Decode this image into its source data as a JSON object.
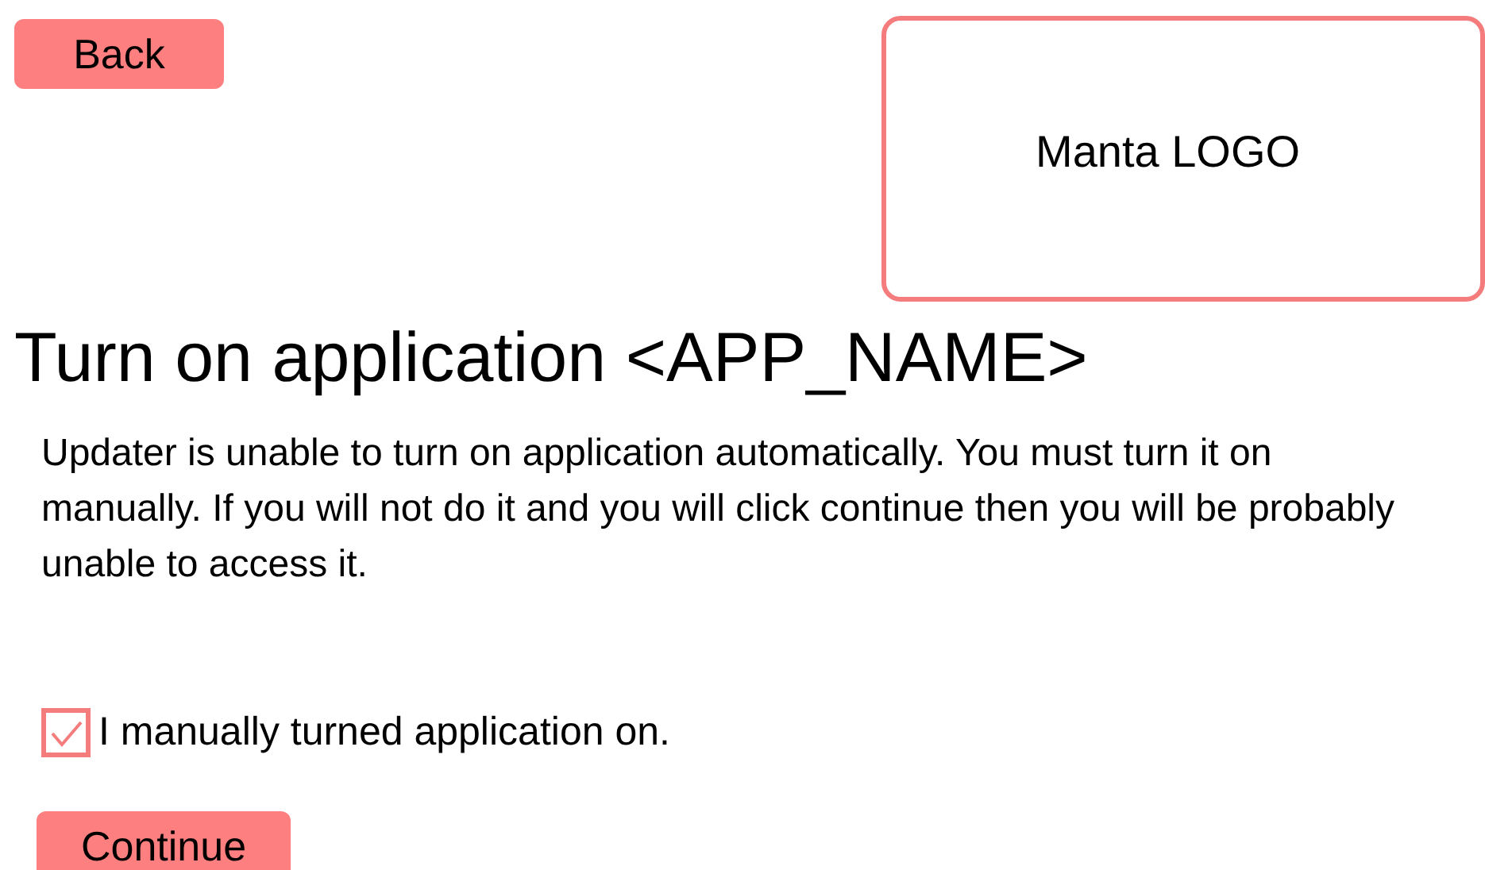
{
  "back_button": {
    "label": "Back"
  },
  "logo": {
    "text": "Manta LOGO"
  },
  "title": "Turn on application <APP_NAME>",
  "message": "Updater is unable to turn on application automatically. You must turn it on manually. If you will not do it and you will click continue then you will be probably unable to access it.",
  "confirm_checkbox": {
    "label": "I manually turned application on.",
    "checked": true
  },
  "continue_button": {
    "label": "Continue"
  }
}
